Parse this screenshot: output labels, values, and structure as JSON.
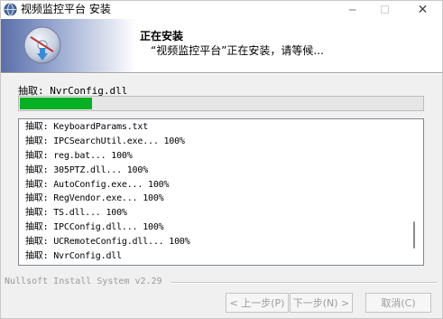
{
  "window": {
    "title": "视频监控平台 安装",
    "icon": "app-globe-icon",
    "controls": {
      "minimize": "─",
      "maximize": "☐",
      "close": "✕"
    }
  },
  "header": {
    "title": "正在安装",
    "subtitle": "“视频监控平台”正在安装，请等候..."
  },
  "status": {
    "current_file": "抽取: NvrConfig.dll",
    "progress_percent": 18
  },
  "log": {
    "items": [
      "抽取: KeyboardParams.txt",
      "抽取: IPCSearchUtil.exe... 100%",
      "抽取: reg.bat... 100%",
      "抽取: 305PTZ.dll... 100%",
      "抽取: AutoConfig.exe... 100%",
      "抽取: RegVendor.exe... 100%",
      "抽取: TS.dll... 100%",
      "抽取: IPCConfig.dll... 100%",
      "抽取: UCRemoteConfig.dll... 100%",
      "抽取: NvrConfig.dll"
    ]
  },
  "footer": {
    "branding": "Nullsoft Install System v2.29",
    "back_label": "< 上一步(P)",
    "next_label": "下一步(N) >",
    "cancel_label": "取消(C)"
  },
  "colors": {
    "progress_fill": "#06b025",
    "disabled_text": "#9c9c9c"
  }
}
